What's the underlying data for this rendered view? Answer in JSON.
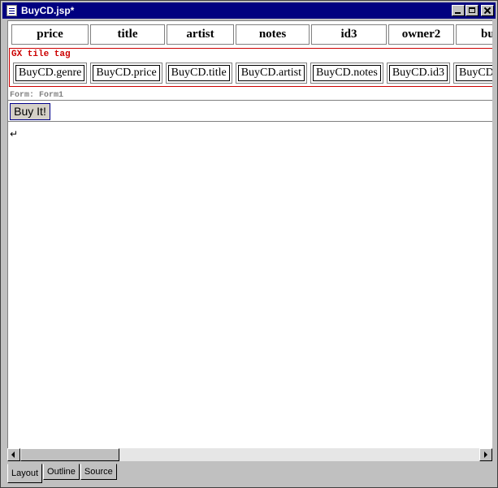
{
  "window": {
    "title": "BuyCD.jsp*"
  },
  "header_cells": [
    {
      "label": "price"
    },
    {
      "label": "title"
    },
    {
      "label": "artist"
    },
    {
      "label": "notes"
    },
    {
      "label": "id3"
    },
    {
      "label": "owner2"
    },
    {
      "label": "bu"
    }
  ],
  "tile_tag": {
    "label": "GX tile tag",
    "tiles": [
      {
        "label": "BuyCD.genre"
      },
      {
        "label": "BuyCD.price"
      },
      {
        "label": "BuyCD.title"
      },
      {
        "label": "BuyCD.artist"
      },
      {
        "label": "BuyCD.notes"
      },
      {
        "label": "BuyCD.id3"
      },
      {
        "label": "BuyCD"
      }
    ]
  },
  "form": {
    "label": "Form: Form1",
    "button_label": "Buy It!"
  },
  "return_mark": "↵",
  "tabs": [
    {
      "label": "Layout",
      "active": true
    },
    {
      "label": "Outline",
      "active": false
    },
    {
      "label": "Source",
      "active": false
    }
  ]
}
